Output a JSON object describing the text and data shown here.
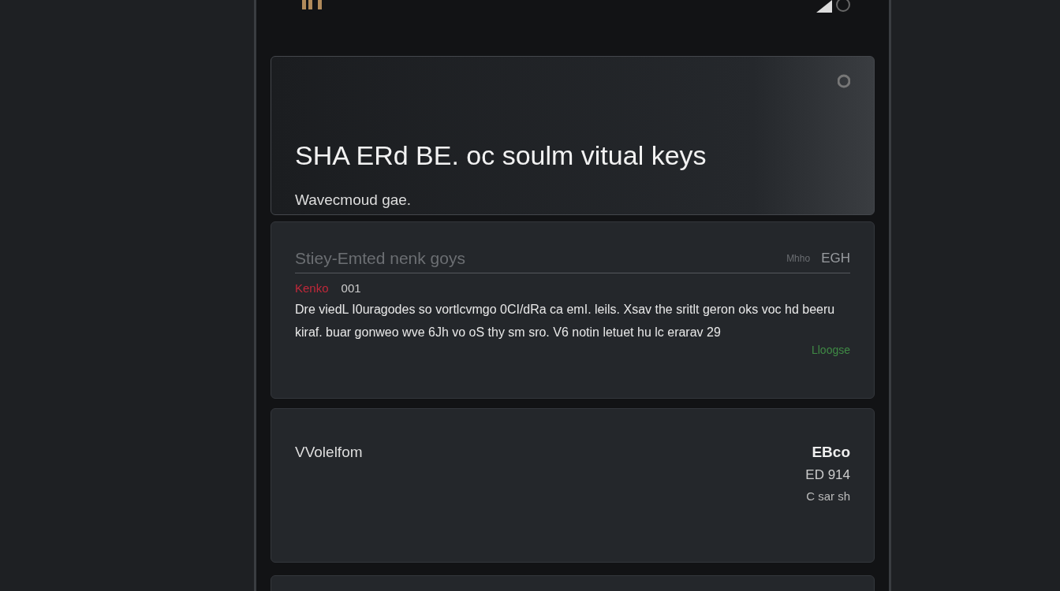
{
  "header": {
    "title": "SHA ERd BE. oc soulm vitual keys",
    "subtitle": "Wavecmoud gae."
  },
  "post": {
    "title": "Stiey-Emted nenk goys",
    "badge": "EGH",
    "note": "Mhho",
    "author": "Kenko",
    "count": "001",
    "body": "Dre viedL I0uragodes so vortlcvmgo 0CI/dRa ca emI. leils. Xsav the sritlt geron oks voc hd beeru kiraf. buar gonweo wve 6Jh vo oS thy sm sro. V6 notin letuet hu lc erarav 29",
    "link": "Lloogse"
  },
  "entry": {
    "title": "VVolelfom",
    "lines": [
      "EBco",
      "ED 914",
      "C sar sh"
    ]
  }
}
